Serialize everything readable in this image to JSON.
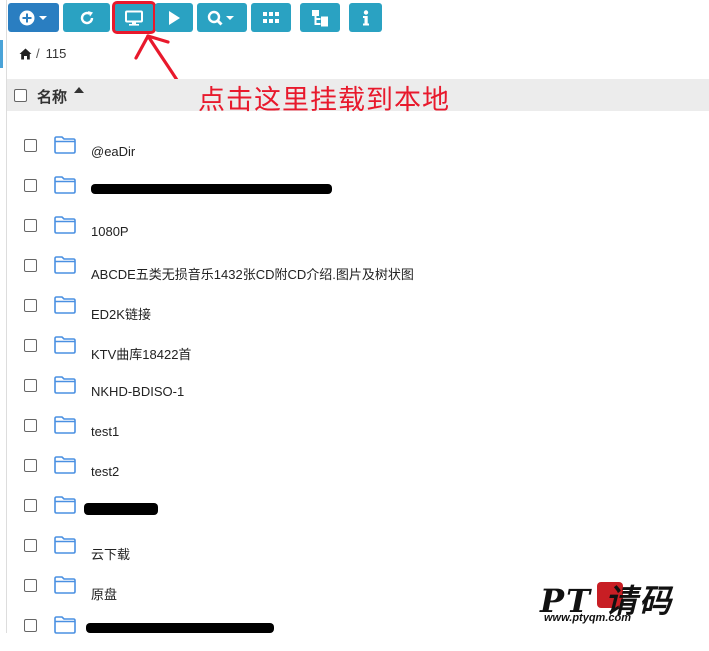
{
  "breadcrumb": {
    "separator": "/",
    "path": "115"
  },
  "header": {
    "name_label": "名称"
  },
  "annotation": {
    "text": "点击这里挂载到本地",
    "color": "#e8192c"
  },
  "toolbar": {
    "buttons": [
      {
        "icon": "add-icon"
      },
      {
        "icon": "refresh-icon"
      },
      {
        "icon": "monitor-icon"
      },
      {
        "icon": "play-icon"
      },
      {
        "icon": "search-icon"
      },
      {
        "icon": "grid-icon"
      },
      {
        "icon": "tree-icon"
      },
      {
        "icon": "info-icon"
      }
    ]
  },
  "files": [
    {
      "name": "@eaDir"
    },
    {
      "name": ""
    },
    {
      "name": "1080P"
    },
    {
      "name": "ABCDE五类无损音乐1432张CD附CD介绍.图片及树状图"
    },
    {
      "name": "ED2K链接"
    },
    {
      "name": "KTV曲库18422首"
    },
    {
      "name": "NKHD-BDISO-1"
    },
    {
      "name": "test1"
    },
    {
      "name": "test2"
    },
    {
      "name": ""
    },
    {
      "name": "云下载"
    },
    {
      "name": "原盘"
    },
    {
      "name": ""
    }
  ],
  "watermark": {
    "text": "PT 请码",
    "url": "www.ptyqm.com"
  },
  "colors": {
    "toolbar_button": "#2aa2c2",
    "primary_button": "#2a7ec1",
    "folder": "#4a90e2"
  }
}
